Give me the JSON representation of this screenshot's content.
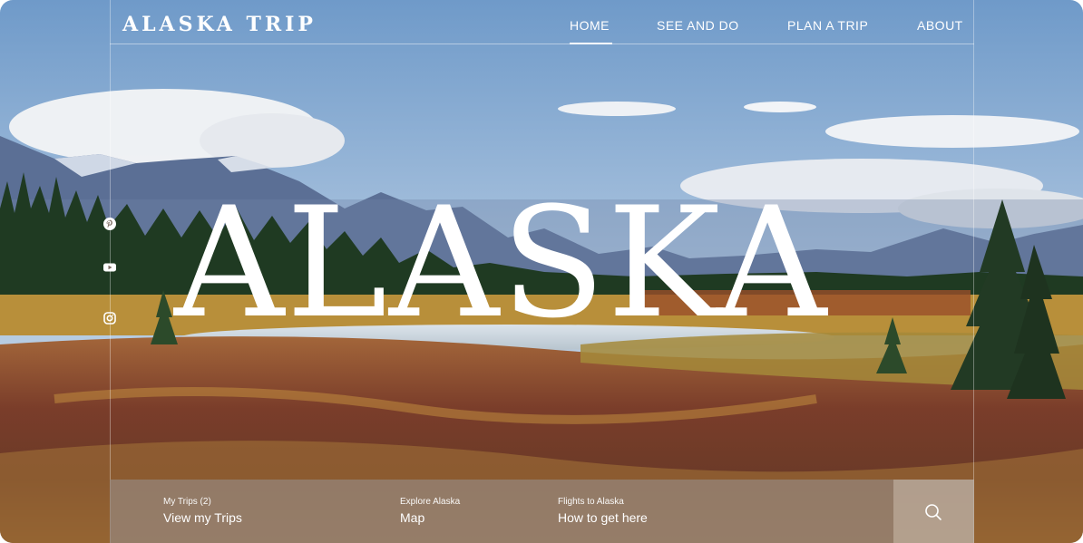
{
  "header": {
    "brand": "ALASKA TRIP",
    "nav": [
      "HOME",
      "SEE AND DO",
      "PLAN A TRIP",
      "ABOUT"
    ]
  },
  "hero": {
    "title": "ALASKA"
  },
  "social": [
    "pinterest-icon",
    "youtube-icon",
    "instagram-icon"
  ],
  "bottom_bar": {
    "items": [
      {
        "label": "My Trips (2)",
        "value": "View my Trips"
      },
      {
        "label": "Explore Alaska",
        "value": "Map"
      },
      {
        "label": "Flights to Alaska",
        "value": "How to get here"
      }
    ],
    "search_icon": "search-icon"
  }
}
